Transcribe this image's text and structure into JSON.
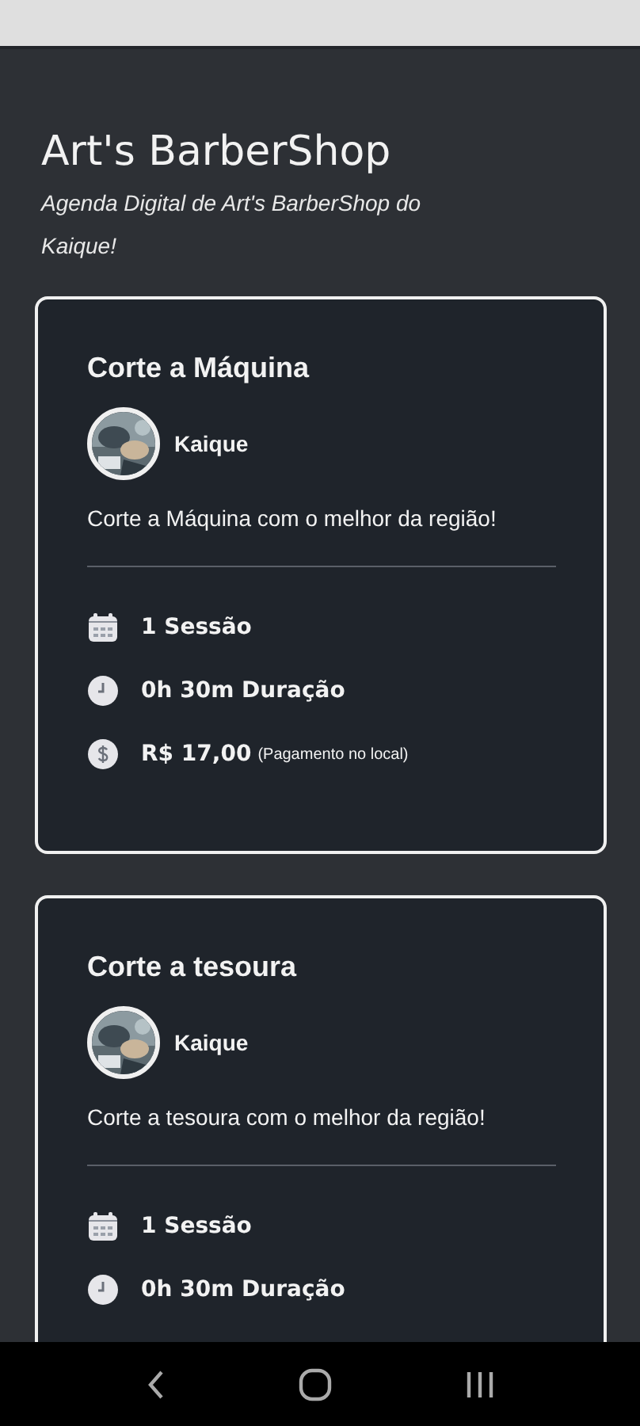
{
  "header": {
    "title": "Art's BarberShop",
    "subtitle": "Agenda Digital de Art's BarberShop do Kaique!"
  },
  "services": [
    {
      "title": "Corte a Máquina",
      "barber": "Kaique",
      "description": "Corte a Máquina com o melhor da região!",
      "details": [
        {
          "kind": "sessions",
          "text": "1 Sessão"
        },
        {
          "kind": "duration",
          "text": "0h 30m Duração"
        },
        {
          "kind": "price",
          "text": "R$ 17,00",
          "note": "(Pagamento no local)"
        }
      ]
    },
    {
      "title": "Corte a tesoura",
      "barber": "Kaique",
      "description": "Corte a tesoura com o melhor da região!",
      "details": [
        {
          "kind": "sessions",
          "text": "1 Sessão"
        },
        {
          "kind": "duration",
          "text": "0h 30m Duração"
        }
      ]
    }
  ]
}
